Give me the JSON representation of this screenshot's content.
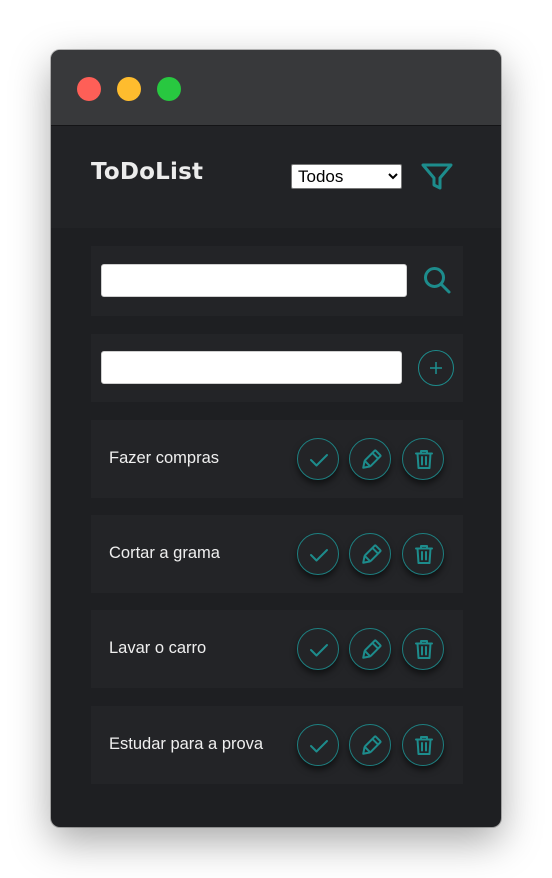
{
  "window": {
    "title_dots": [
      "close",
      "minimize",
      "maximize"
    ]
  },
  "header": {
    "title": "ToDoList",
    "filter_selected": "Todos",
    "filter_icon": "filter-icon"
  },
  "search": {
    "value": "",
    "icon": "search-icon"
  },
  "add": {
    "value": "",
    "icon": "plus-icon"
  },
  "todos": [
    {
      "label": "Fazer compras"
    },
    {
      "label": "Cortar a grama"
    },
    {
      "label": "Lavar o carro"
    },
    {
      "label": "Estudar para a prova"
    }
  ],
  "colors": {
    "accent": "#1d8c8c",
    "background": "#1e1f22",
    "card": "#232427",
    "titlebar": "#38393b",
    "close": "#fe5f57",
    "minimize": "#febc2e",
    "maximize": "#28c840"
  }
}
